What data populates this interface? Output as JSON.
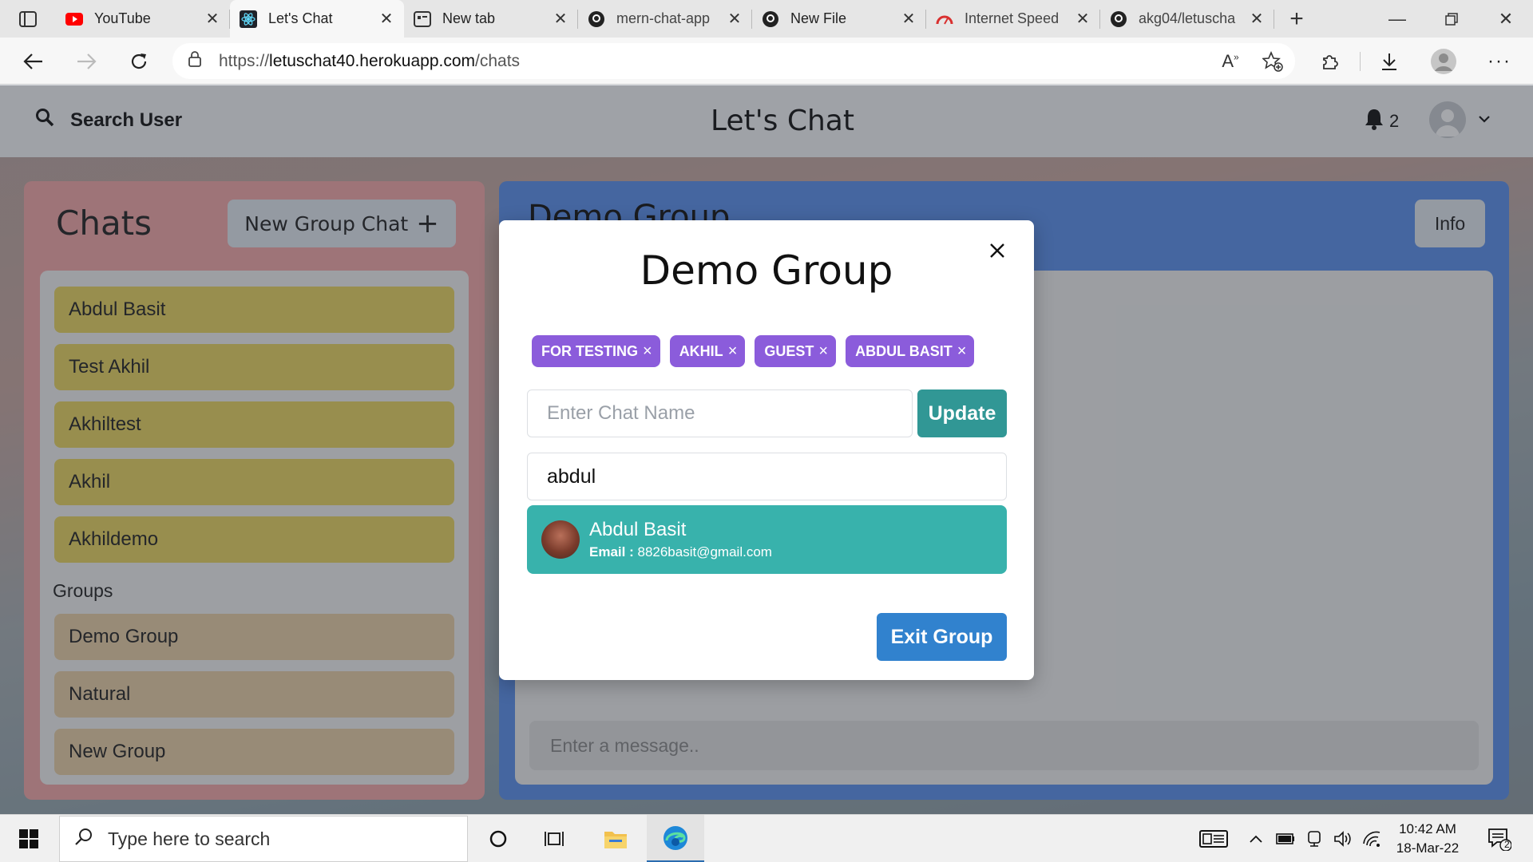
{
  "browser": {
    "tabs": [
      {
        "label": "YouTube",
        "icon": "youtube-icon",
        "active": false
      },
      {
        "label": "Let's Chat",
        "icon": "react-icon",
        "active": true
      },
      {
        "label": "New tab",
        "icon": "newtab-icon",
        "active": false
      },
      {
        "label": "mern-chat-app",
        "icon": "github-icon",
        "active": false
      },
      {
        "label": "New File",
        "icon": "github-icon",
        "active": false
      },
      {
        "label": "Internet Speed",
        "icon": "speedometer-icon",
        "active": false
      },
      {
        "label": "akg04/letuscha",
        "icon": "github-icon",
        "active": false
      }
    ],
    "url_prefix": "https://",
    "url_host": "letuschat40.herokuapp.com",
    "url_path": "/chats"
  },
  "header": {
    "search_label": "Search User",
    "app_title": "Let's Chat",
    "notification_count": "2"
  },
  "chats": {
    "title": "Chats",
    "new_group_label": "New Group Chat",
    "items": [
      "Abdul Basit",
      "Test Akhil",
      "Akhiltest",
      "Akhil",
      "Akhildemo"
    ],
    "groups_label": "Groups",
    "groups": [
      "Demo Group",
      "Natural",
      "New Group"
    ]
  },
  "conversation": {
    "title": "Demo Group",
    "info_label": "Info",
    "message_placeholder": "Enter a message.."
  },
  "modal": {
    "title": "Demo Group",
    "members": [
      "FOR TESTING",
      "AKHIL",
      "GUEST",
      "ABDUL BASIT"
    ],
    "chat_name_placeholder": "Enter Chat Name",
    "update_label": "Update",
    "add_user_value": "abdul",
    "result": {
      "name": "Abdul Basit",
      "email_label": "Email :",
      "email": "8826basit@gmail.com"
    },
    "exit_label": "Exit Group"
  },
  "taskbar": {
    "search_placeholder": "Type here to search",
    "time": "10:42 AM",
    "date": "18-Mar-22",
    "notification_count": "2"
  },
  "colors": {
    "badge": "#8b5cdb",
    "update": "#319795",
    "result": "#38b2ac",
    "exit": "#3182ce",
    "chat_item": "#e9d45f",
    "group_item": "#e9cfa6"
  }
}
